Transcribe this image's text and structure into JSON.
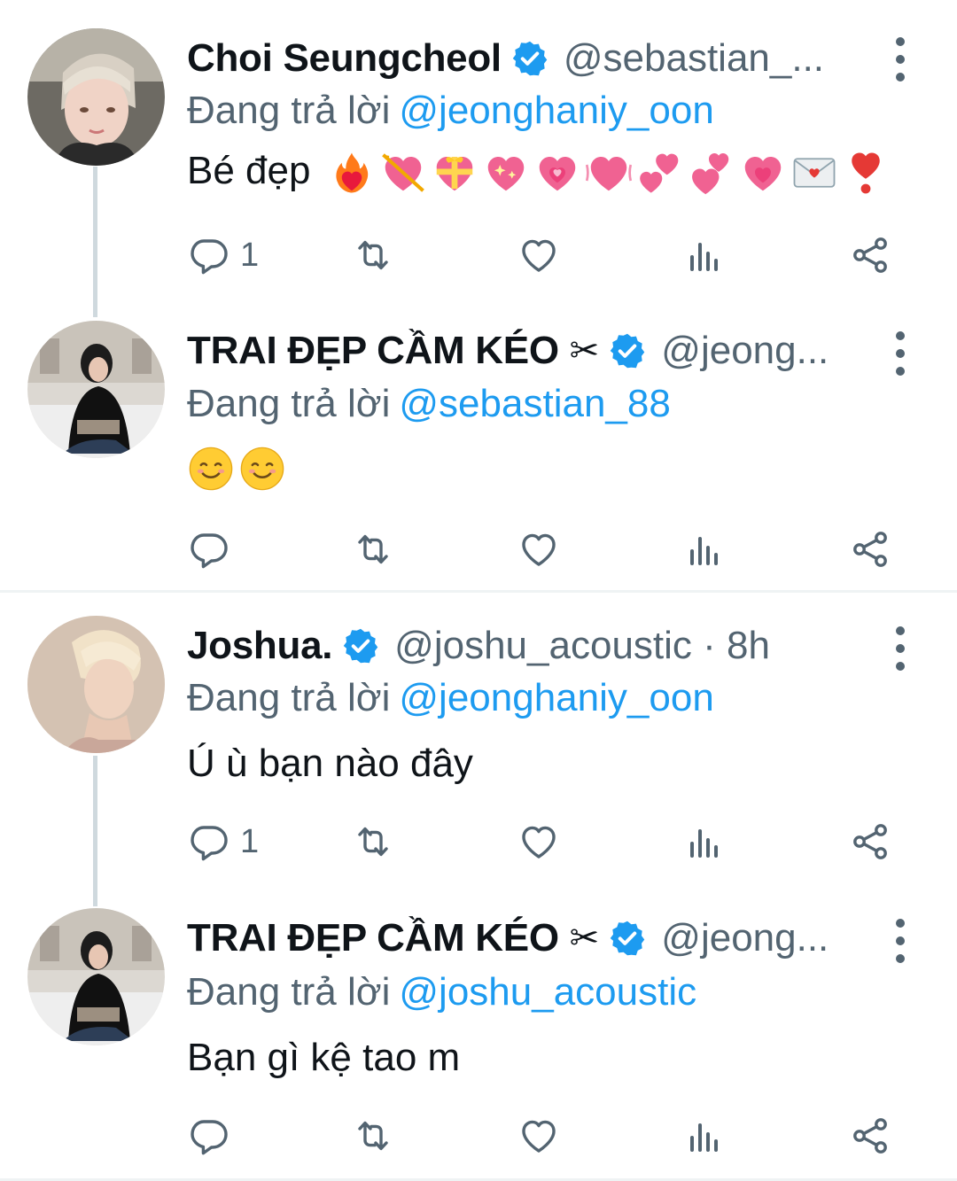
{
  "tweets": [
    {
      "name": "Choi Seungcheol",
      "handle": "@sebastian_...",
      "reply_prefix": "Đang trả lời",
      "reply_to": "@jeonghaniy_oon",
      "text": "Bé đẹp",
      "emojis": [
        "heart-on-fire",
        "heart-with-arrow",
        "heart-with-ribbon",
        "sparkling-heart",
        "growing-heart",
        "beating-heart",
        "revolving-hearts",
        "two-hearts",
        "growing-heart",
        "love-letter",
        "red-exclamation-heart"
      ],
      "reply_count": "1"
    },
    {
      "name": "TRAI ĐẸP CẦM KÉO",
      "name_emoji": "✂",
      "handle": "@jeong...",
      "reply_prefix": "Đang trả lời",
      "reply_to": "@sebastian_88",
      "emojis": [
        "smiling-face",
        "smiling-face"
      ],
      "reply_count": ""
    },
    {
      "name": "Joshua.",
      "handle": "@joshu_acoustic · 8h",
      "reply_prefix": "Đang trả lời",
      "reply_to": "@jeonghaniy_oon",
      "text": "Ú ù bạn nào đây",
      "reply_count": "1"
    },
    {
      "name": "TRAI ĐẸP CẦM KÉO",
      "name_emoji": "✂",
      "handle": "@jeong...",
      "reply_prefix": "Đang trả lời",
      "reply_to": "@joshu_acoustic",
      "text": "Bạn gì kệ tao m",
      "reply_count": ""
    }
  ],
  "colors": {
    "text": "#0f1419",
    "secondary": "#536471",
    "link": "#1d9bf0",
    "verified": "#1d9bf0",
    "thread_line": "#cfd9de",
    "divider": "#eff3f4"
  },
  "icons": [
    "reply-icon",
    "retweet-icon",
    "like-icon",
    "views-icon",
    "share-icon",
    "more-icon",
    "verified-badge-icon"
  ]
}
